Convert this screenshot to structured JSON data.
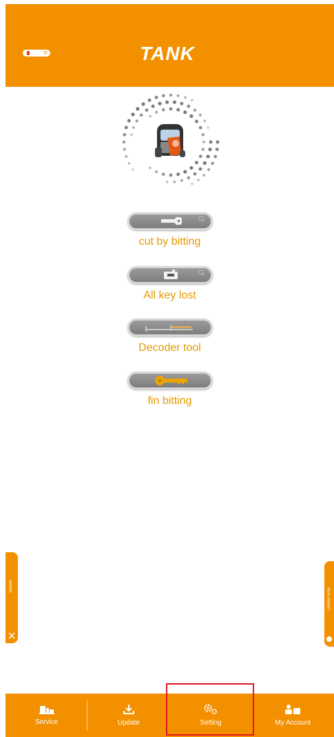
{
  "header": {
    "brand": "TANK",
    "battery_text": "ıp"
  },
  "functions": [
    {
      "label": "cut by bitting",
      "icon": "key-cut-icon"
    },
    {
      "label": "All key lost",
      "icon": "key-lost-icon"
    },
    {
      "label": "Decoder tool",
      "icon": "decoder-tool-icon"
    },
    {
      "label": "fin bitting",
      "icon": "gold-key-icon"
    }
  ],
  "side_tabs": {
    "left_text": "Stands",
    "right_text": "Lineate scan"
  },
  "nav": [
    {
      "label": "Service",
      "icon": "service-icon"
    },
    {
      "label": "Update",
      "icon": "download-icon"
    },
    {
      "label": "Setting",
      "icon": "gears-icon"
    },
    {
      "label": "My Account",
      "icon": "account-icon"
    }
  ],
  "colors": {
    "accent": "#f39000",
    "label": "#e39a00",
    "highlight": "#e0161d"
  }
}
